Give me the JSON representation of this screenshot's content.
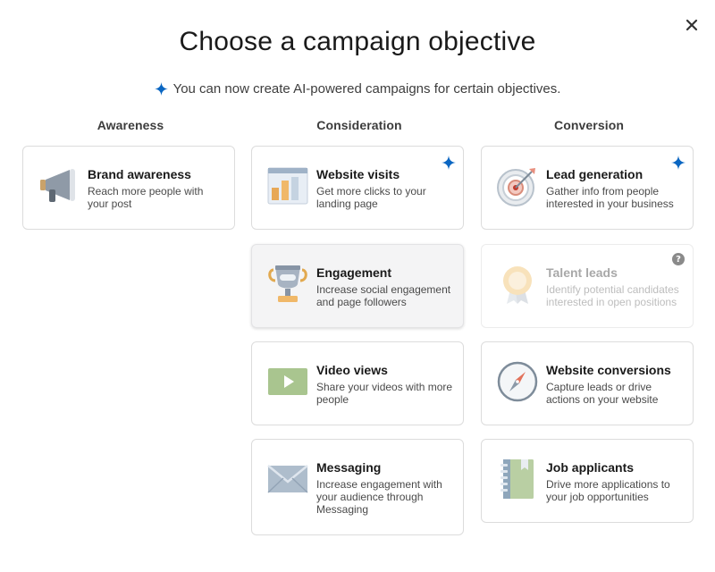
{
  "modal": {
    "title": "Choose a campaign objective",
    "ai_notice": "You can now create AI-powered campaigns for certain objectives.",
    "close_icon": "close-icon",
    "accent_color": "#0a66c2"
  },
  "columns": [
    {
      "heading": "Awareness"
    },
    {
      "heading": "Consideration"
    },
    {
      "heading": "Conversion"
    }
  ],
  "objectives": {
    "brand_awareness": {
      "title": "Brand awareness",
      "description": "Reach more people with your post",
      "icon": "megaphone-icon"
    },
    "website_visits": {
      "title": "Website visits",
      "description": "Get more clicks to your landing page",
      "icon": "landing-page-icon",
      "ai_powered": true
    },
    "engagement": {
      "title": "Engagement",
      "description": "Increase social engagement and page followers",
      "icon": "trophy-icon",
      "state": "hover"
    },
    "video_views": {
      "title": "Video views",
      "description": "Share your videos with more people",
      "icon": "video-play-icon"
    },
    "messaging": {
      "title": "Messaging",
      "description": "Increase engagement with your audience through Messaging",
      "icon": "envelope-icon"
    },
    "lead_generation": {
      "title": "Lead generation",
      "description": "Gather info from people interested in your business",
      "icon": "target-icon",
      "ai_powered": true
    },
    "talent_leads": {
      "title": "Talent leads",
      "description": "Identify potential candidates interested in open positions",
      "icon": "badge-icon",
      "state": "disabled",
      "help": "?"
    },
    "website_conversions": {
      "title": "Website conversions",
      "description": "Capture leads or drive actions on your website",
      "icon": "compass-icon"
    },
    "job_applicants": {
      "title": "Job applicants",
      "description": "Drive more applications to your job opportunities",
      "icon": "notebook-icon"
    }
  }
}
